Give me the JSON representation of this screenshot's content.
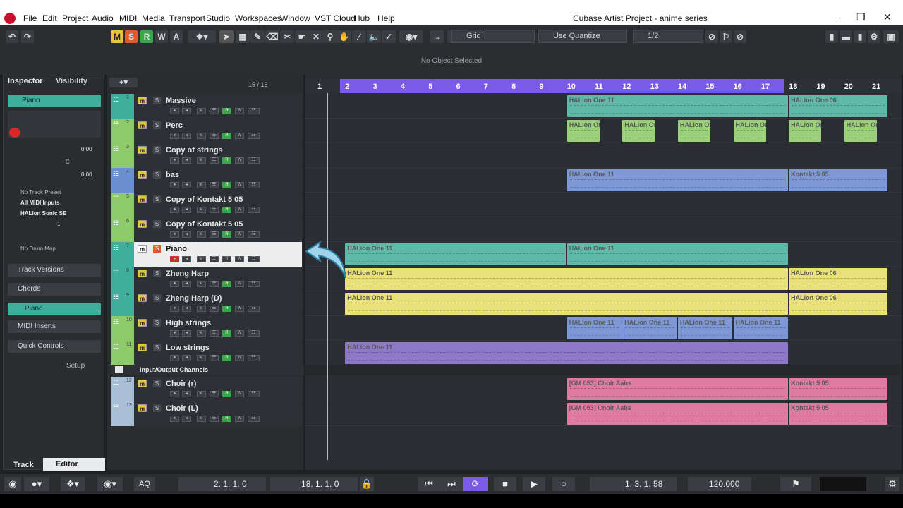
{
  "window": {
    "title": "Cubase Artist Project - anime series",
    "menu": [
      "File",
      "Edit",
      "Project",
      "Audio",
      "MIDI",
      "Media",
      "Transport",
      "Studio",
      "Workspaces",
      "Window",
      "VST Cloud",
      "Hub",
      "Help"
    ]
  },
  "toolbar": {
    "m": "M",
    "s": "S",
    "r": "R",
    "w": "W",
    "a": "A",
    "snap_type": "Grid",
    "quantize_mode": "Use Quantize",
    "quantize_value": "1/2",
    "status": "No Object Selected"
  },
  "inspector": {
    "tab_inspector": "Inspector",
    "tab_visibility": "Visibility",
    "track_name": "Piano",
    "vol": "0.00",
    "pan": "C",
    "delay": "0.00",
    "preset": "No Track Preset",
    "midi_input": "All MIDI Inputs",
    "instrument": "HALion Sonic SE",
    "channel": "1",
    "drum_map": "No Drum Map",
    "sections": [
      "Track Versions",
      "Chords",
      "Piano",
      "MIDI Inserts",
      "Quick Controls"
    ],
    "setup": "Setup",
    "bottom_tab_track": "Track",
    "bottom_tab_editor": "Editor"
  },
  "tracklist": {
    "count": "15 / 16",
    "tracks": [
      {
        "num": "1",
        "name": "Massive",
        "color": "#3fae9a"
      },
      {
        "num": "2",
        "name": "Perc",
        "color": "#8fca6a"
      },
      {
        "num": "3",
        "name": "Copy of strings",
        "color": "#8fca6a"
      },
      {
        "num": "4",
        "name": "bas",
        "color": "#6c8fd0"
      },
      {
        "num": "5",
        "name": "Copy of Kontakt 5 05",
        "color": "#8fca6a"
      },
      {
        "num": "6",
        "name": "Copy of Kontakt 5 05",
        "color": "#8fca6a"
      },
      {
        "num": "7",
        "name": "Piano",
        "color": "#3fae9a"
      },
      {
        "num": "8",
        "name": "Zheng Harp",
        "color": "#3fae9a"
      },
      {
        "num": "9",
        "name": "Zheng Harp (D)",
        "color": "#3fae9a"
      },
      {
        "num": "10",
        "name": "High strings",
        "color": "#8fca6a"
      },
      {
        "num": "11",
        "name": "Low strings",
        "color": "#8fca6a"
      }
    ],
    "folder": "Input/Output Channels",
    "tracks2": [
      {
        "num": "12",
        "name": "Choir (r)"
      },
      {
        "num": "13",
        "name": "Choir (L)"
      }
    ]
  },
  "ruler": [
    "1",
    "2",
    "3",
    "4",
    "5",
    "6",
    "7",
    "8",
    "9",
    "10",
    "11",
    "12",
    "13",
    "14",
    "15",
    "16",
    "17",
    "18",
    "19",
    "20",
    "21"
  ],
  "parts": {
    "hal11": "HALion One 11",
    "hal06": "HALion One 06",
    "halshort": "HALion Or",
    "kontakt": "Kontakt 5 05",
    "choir": "[GM 053] Choir Aahs"
  },
  "transport": {
    "left_locator": "2. 1. 1.   0",
    "right_locator": "18. 1. 1.   0",
    "position": "1. 3. 1. 58",
    "tempo": "120.000",
    "aq": "AQ"
  },
  "colors": {
    "cycle": "#7a5be8",
    "teal": "#5fb8a8",
    "green": "#9bd07a",
    "blue": "#7e98d6",
    "yellow": "#e9e07a",
    "purple": "#8e78c8",
    "pink": "#e07aa0"
  }
}
